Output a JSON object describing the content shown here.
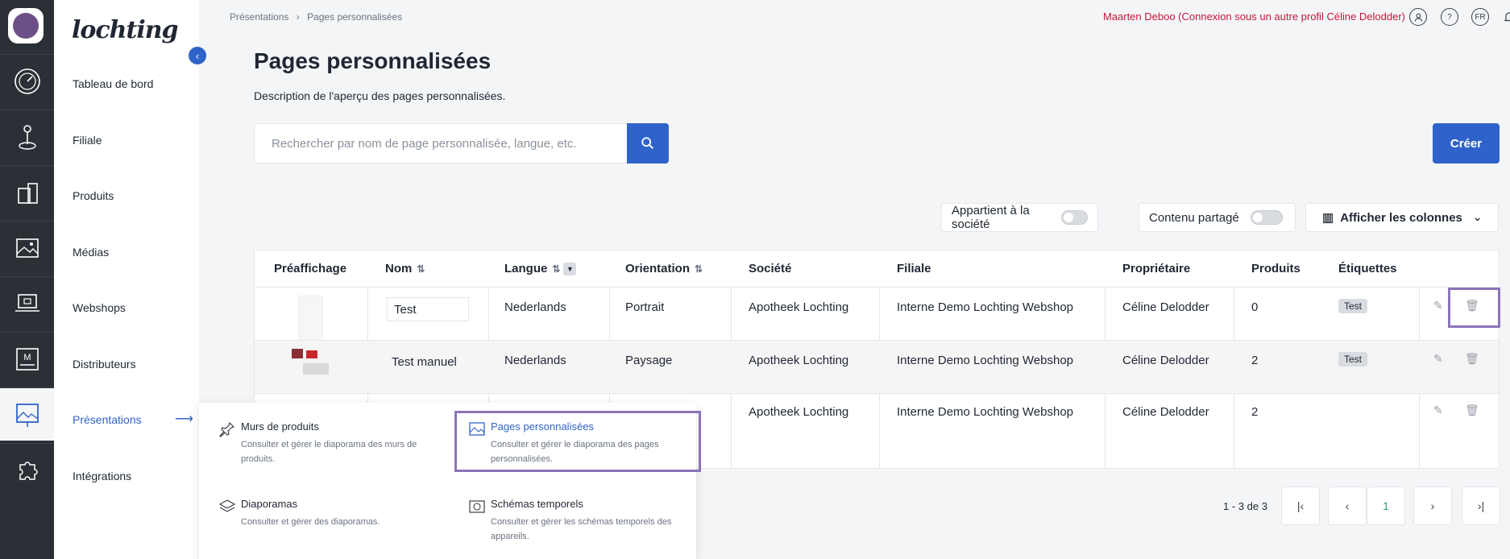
{
  "app": {
    "brand": "lochting"
  },
  "nav": {
    "items": [
      "Tableau de bord",
      "Filiale",
      "Produits",
      "Médias",
      "Webshops",
      "Distributeurs",
      "Présentations",
      "Intégrations"
    ],
    "active_index": 6
  },
  "rail_icons": [
    "dashboard-icon",
    "location-icon",
    "products-icon",
    "media-icon",
    "webshop-icon",
    "distributor-icon",
    "presentation-icon",
    "integrations-icon"
  ],
  "breadcrumb": [
    "Présentations",
    "›",
    "Pages personnalisées"
  ],
  "header": {
    "user": "Maarten Deboo (Connexion sous un autre profil Céline Delodder)",
    "help": "?",
    "lang": "FR"
  },
  "page": {
    "title": "Pages personnalisées",
    "description": "Description de l'aperçu des pages personnalisées."
  },
  "search": {
    "placeholder": "Rechercher par nom de page personnalisée, langue, etc."
  },
  "create_label": "Créer",
  "filters": {
    "owned": "Appartient à la société",
    "shared": "Contenu partagé",
    "columns": "Afficher les colonnes"
  },
  "table": {
    "headers": [
      "Préaffichage",
      "Nom",
      "Langue",
      "Orientation",
      "Société",
      "Filiale",
      "Propriétaire",
      "Produits",
      "Étiquettes"
    ],
    "rows": [
      {
        "name": "Test",
        "language": "Nederlands",
        "orientation": "Portrait",
        "company": "Apotheek Lochting",
        "branch": "Interne Demo Lochting Webshop",
        "owner": "Céline Delodder",
        "products": "0",
        "tag": "Test"
      },
      {
        "name": "Test manuel",
        "language": "Nederlands",
        "orientation": "Paysage",
        "company": "Apotheek Lochting",
        "branch": "Interne Demo Lochting Webshop",
        "owner": "Céline Delodder",
        "products": "2",
        "tag": "Test"
      },
      {
        "name": "",
        "language": "",
        "orientation": "",
        "company": "Apotheek Lochting",
        "branch": "Interne Demo Lochting Webshop",
        "owner": "Céline Delodder",
        "products": "2",
        "tag": ""
      }
    ]
  },
  "pagination": {
    "info": "1 - 3 de 3",
    "page": "1"
  },
  "dropdown": {
    "items": [
      {
        "title": "Murs de produits",
        "desc": "Consulter et gérer le diaporama des murs de produits."
      },
      {
        "title": "Pages personnalisées",
        "desc": "Consulter et gérer le diaporama des pages personnalisées."
      },
      {
        "title": "Diaporamas",
        "desc": "Consulter et gérer des diaporamas."
      },
      {
        "title": "Schémas temporels",
        "desc": "Consulter et gérer les schémas temporels des appareils."
      }
    ]
  }
}
